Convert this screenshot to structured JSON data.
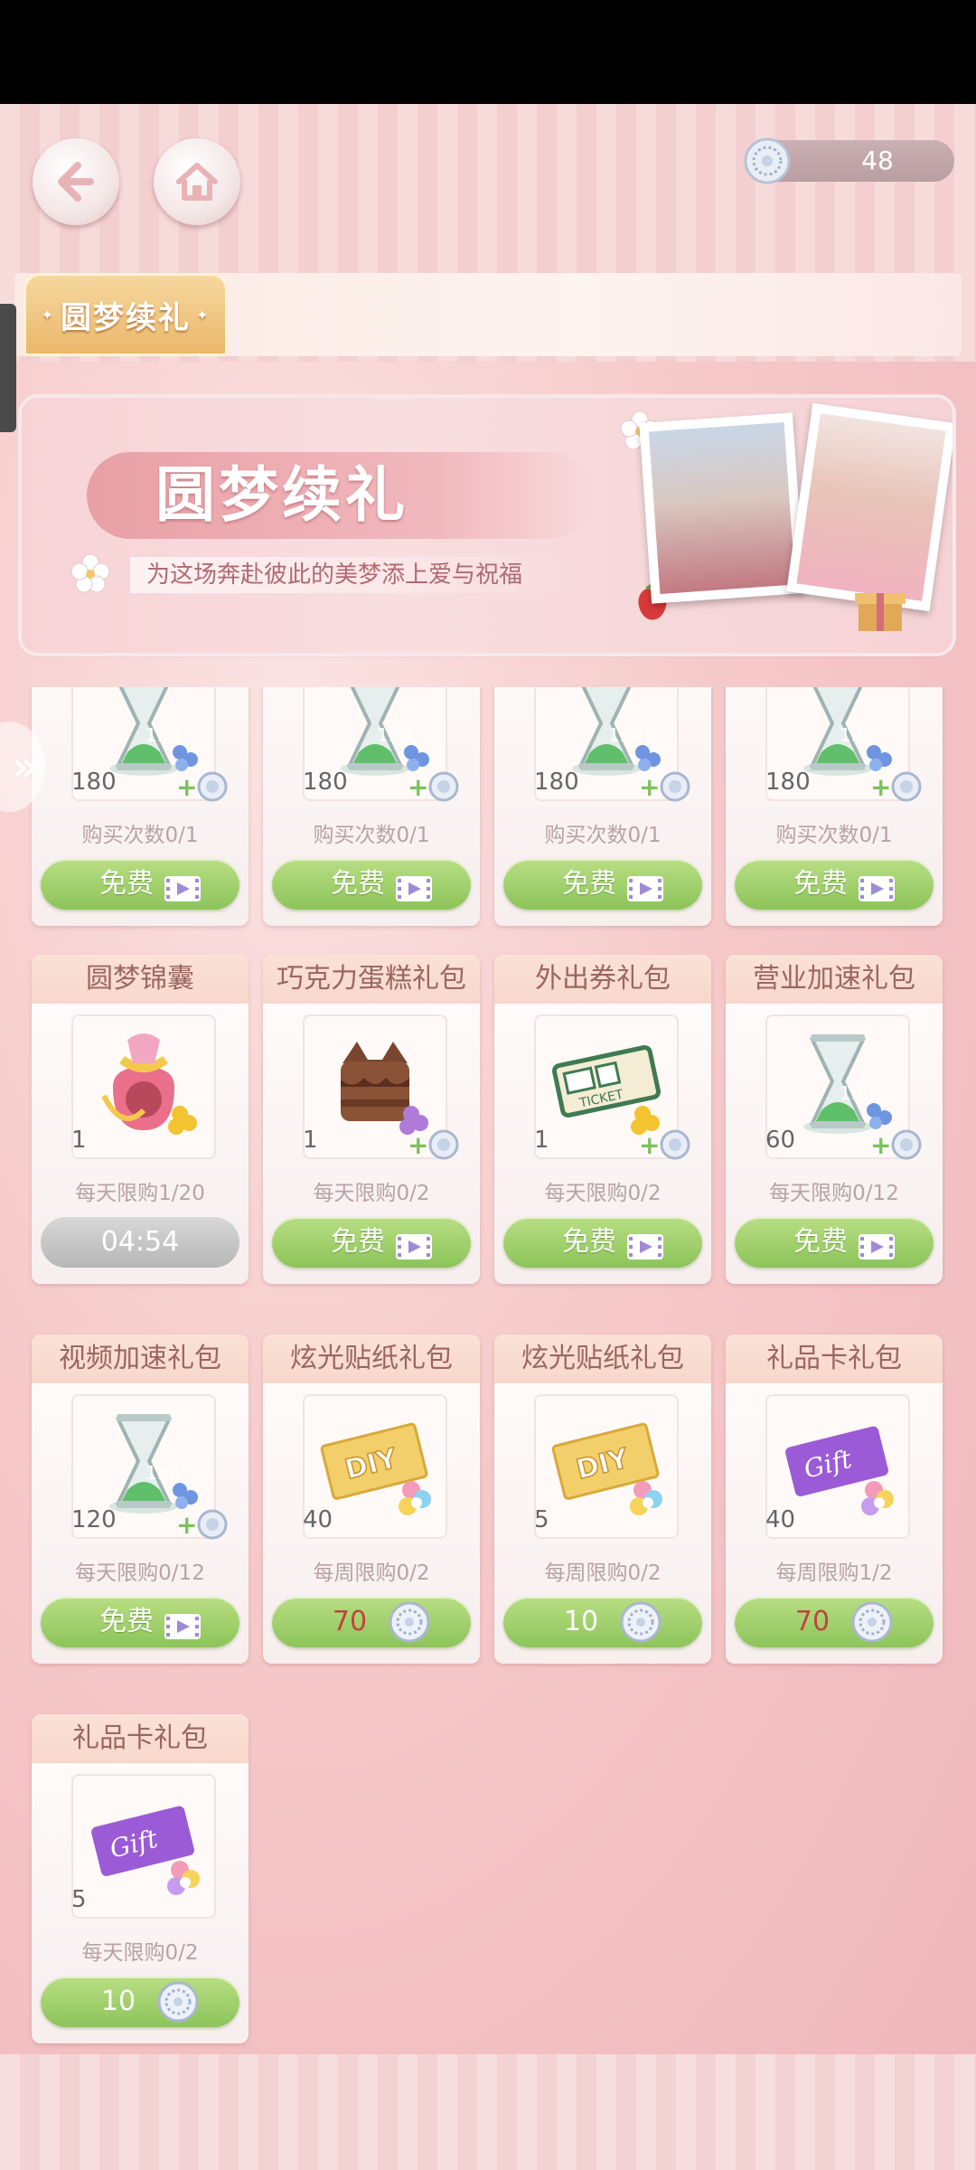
{
  "header": {
    "back_icon": "back-arrow-icon",
    "home_icon": "home-icon",
    "currency_icon": "diamond-coin-icon",
    "currency_value": "48"
  },
  "tabs": [
    {
      "label": "圆梦续礼",
      "active": true
    }
  ],
  "banner": {
    "title": "圆梦续礼",
    "subtitle": "为这场奔赴彼此的美梦添上爱与祝福"
  },
  "cards": [
    {
      "title": "",
      "item": "hourglass",
      "qty": "180",
      "limit": "购买次数0/1",
      "button": {
        "type": "free",
        "label": "免费"
      }
    },
    {
      "title": "",
      "item": "hourglass",
      "qty": "180",
      "limit": "购买次数0/1",
      "button": {
        "type": "free",
        "label": "免费"
      }
    },
    {
      "title": "",
      "item": "hourglass",
      "qty": "180",
      "limit": "购买次数0/1",
      "button": {
        "type": "free",
        "label": "免费"
      }
    },
    {
      "title": "",
      "item": "hourglass",
      "qty": "180",
      "limit": "购买次数0/1",
      "button": {
        "type": "free",
        "label": "免费"
      }
    },
    {
      "title": "圆梦锦囊",
      "item": "lucky-bag",
      "qty": "1",
      "limit": "每天限购1/20",
      "button": {
        "type": "timer",
        "label": "04:54"
      }
    },
    {
      "title": "巧克力蛋糕礼包",
      "item": "chocolate-cake",
      "qty": "1",
      "limit": "每天限购0/2",
      "button": {
        "type": "free",
        "label": "免费"
      }
    },
    {
      "title": "外出券礼包",
      "item": "ticket",
      "qty": "1",
      "limit": "每天限购0/2",
      "button": {
        "type": "free",
        "label": "免费"
      }
    },
    {
      "title": "营业加速礼包",
      "item": "hourglass",
      "qty": "60",
      "limit": "每天限购0/12",
      "button": {
        "type": "free",
        "label": "免费"
      }
    },
    {
      "title": "视频加速礼包",
      "item": "hourglass",
      "qty": "120",
      "limit": "每天限购0/12",
      "button": {
        "type": "free",
        "label": "免费"
      }
    },
    {
      "title": "炫光贴纸礼包",
      "item": "diy-sticker",
      "qty": "40",
      "limit": "每周限购0/2",
      "button": {
        "type": "price",
        "price": "70",
        "red": true
      }
    },
    {
      "title": "炫光贴纸礼包",
      "item": "diy-sticker",
      "qty": "5",
      "limit": "每周限购0/2",
      "button": {
        "type": "price",
        "price": "10",
        "red": false
      }
    },
    {
      "title": "礼品卡礼包",
      "item": "gift-card",
      "qty": "40",
      "limit": "每周限购1/2",
      "button": {
        "type": "price",
        "price": "70",
        "red": true
      }
    },
    {
      "title": "礼品卡礼包",
      "item": "gift-card",
      "qty": "5",
      "limit": "每天限购0/2",
      "button": {
        "type": "price",
        "price": "10",
        "red": false
      }
    }
  ],
  "colors": {
    "accent_green": "#8cc459",
    "price_red": "#c0443c",
    "tab_gold": "#eab66a"
  }
}
